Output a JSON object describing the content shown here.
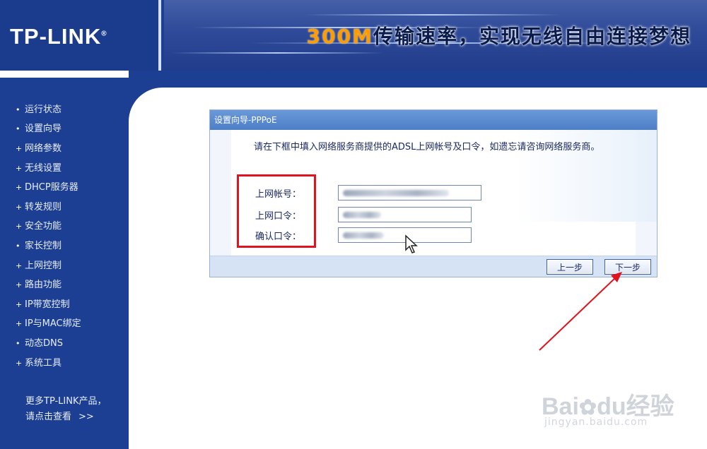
{
  "header": {
    "logo": "TP-LINK",
    "logo_mark": "®",
    "slogan_accent": "300M",
    "slogan_text": "传输速率，实现无线自由连接梦想"
  },
  "sidebar": {
    "items": [
      {
        "label": "运行状态"
      },
      {
        "label": "设置向导"
      },
      {
        "label": "网络参数"
      },
      {
        "label": "无线设置"
      },
      {
        "label": "DHCP服务器"
      },
      {
        "label": "转发规则"
      },
      {
        "label": "安全功能"
      },
      {
        "label": "家长控制"
      },
      {
        "label": "上网控制"
      },
      {
        "label": "路由功能"
      },
      {
        "label": "IP带宽控制"
      },
      {
        "label": "IP与MAC绑定"
      },
      {
        "label": "动态DNS"
      },
      {
        "label": "系统工具"
      }
    ],
    "more_line1": "更多TP-LINK产品，",
    "more_line2": "请点击查看",
    "more_arrows": ">>"
  },
  "dialog": {
    "title": "设置向导-PPPoE",
    "intro": "请在下框中填入网络服务商提供的ADSL上网帐号及口令，如遗忘请咨询网络服务商。",
    "fields": {
      "account_label": "上网帐号：",
      "password_label": "上网口令：",
      "confirm_label": "确认口令："
    },
    "buttons": {
      "prev": "上一步",
      "next": "下一步"
    }
  },
  "watermark": {
    "brand": "Bai",
    "brand_tail": "du",
    "cn": "经验",
    "url": "jingyan.baidu.com"
  },
  "colors": {
    "nav_blue": "#1c3f93",
    "annotation_red": "#e0141e",
    "accent_orange": "#ff9c00"
  }
}
